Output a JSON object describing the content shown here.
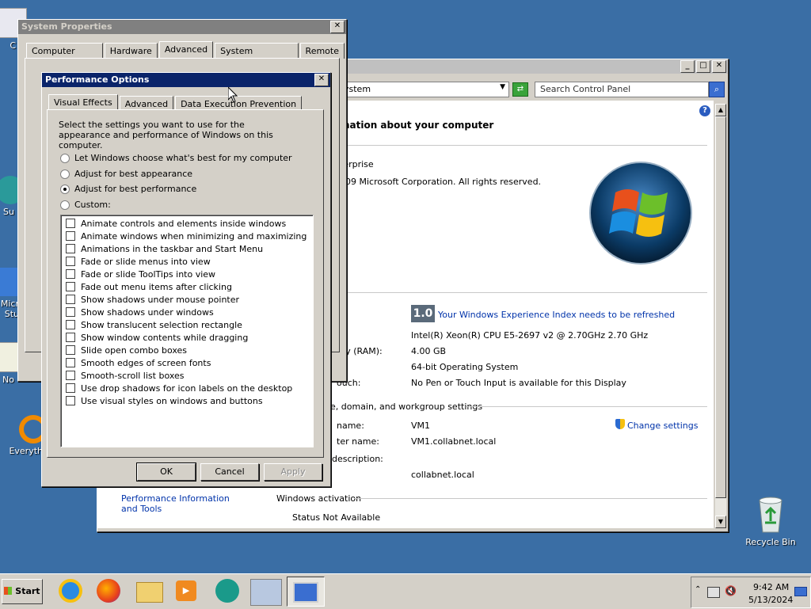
{
  "desktop": {
    "recycle_bin_label": "Recycle Bin",
    "partial_icons": [
      "C",
      "Su",
      "Micr",
      "Stu",
      "No",
      "Everyth"
    ]
  },
  "control_panel": {
    "address_text": "ystem",
    "search_placeholder": "Search Control Panel",
    "heading": "mation about your computer",
    "edition": "terprise",
    "copyright": "009 Microsoft Corporation.  All rights reserved.",
    "wei_score": "1.0",
    "wei_text": "Your Windows Experience Index needs to be refreshed",
    "processor": "Intel(R) Xeon(R) CPU E5-2697 v2 @ 2.70GHz   2.70 GHz",
    "ram_label": "ory (RAM):",
    "ram_value": "4.00 GB",
    "system_type": "64-bit Operating System",
    "pen_label": "ouch:",
    "pen_value": "No Pen or Touch Input is available for this Display",
    "domain_section": "e, domain, and workgroup settings",
    "name_label": "name:",
    "name_value": "VM1",
    "full_name_label": "ter name:",
    "full_name_value": "VM1.collabnet.local",
    "desc_label": "description:",
    "domain_value": "collabnet.local",
    "change_settings": "Change settings",
    "perf_link": "Performance Information and Tools",
    "activation_section": "Windows activation",
    "activation_status": "Status Not Available"
  },
  "system_properties": {
    "title": "System Properties",
    "tabs": [
      "Computer Name",
      "Hardware",
      "Advanced",
      "System Protection",
      "Remote"
    ]
  },
  "perf_options": {
    "title": "Performance Options",
    "tabs": [
      "Visual Effects",
      "Advanced",
      "Data Execution Prevention"
    ],
    "description": "Select the settings you want to use for the appearance and performance of Windows on this computer.",
    "radios": [
      {
        "label": "Let Windows choose what's best for my computer",
        "checked": false
      },
      {
        "label": "Adjust for best appearance",
        "checked": false
      },
      {
        "label": "Adjust for best performance",
        "checked": true
      },
      {
        "label": "Custom:",
        "checked": false
      }
    ],
    "effects": [
      "Animate controls and elements inside windows",
      "Animate windows when minimizing and maximizing",
      "Animations in the taskbar and Start Menu",
      "Fade or slide menus into view",
      "Fade or slide ToolTips into view",
      "Fade out menu items after clicking",
      "Show shadows under mouse pointer",
      "Show shadows under windows",
      "Show translucent selection rectangle",
      "Show window contents while dragging",
      "Slide open combo boxes",
      "Smooth edges of screen fonts",
      "Smooth-scroll list boxes",
      "Use drop shadows for icon labels on the desktop",
      "Use visual styles on windows and buttons"
    ],
    "ok": "OK",
    "cancel": "Cancel",
    "apply": "Apply"
  },
  "taskbar": {
    "start": "Start",
    "time": "9:42 AM",
    "date": "5/13/2024"
  }
}
